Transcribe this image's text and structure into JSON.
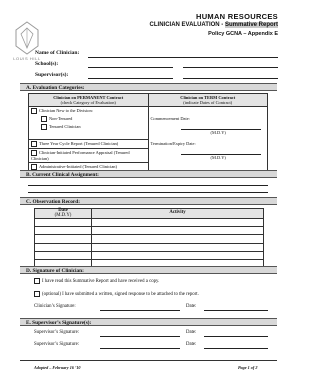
{
  "header": {
    "logo_text": "LOUIS HILL",
    "line1": "HUMAN RESOURCES",
    "line2_prefix": "CLINICIAN EVALUATION - ",
    "line2_highlight": "Summative Report",
    "line3": "Policy GCNA – Appendix E"
  },
  "fields": {
    "name_label": "Name of Clinician:",
    "schools_label": "School(s):",
    "supervisors_label": "Supervisor(s):"
  },
  "section_a": {
    "title": "A.  Evaluation Categories:",
    "permanent_head": "Clinician on PERMANENT Contract",
    "permanent_sub": "(check Category of Evaluation)",
    "term_head": "Clinician on TERM Contract",
    "term_sub": "(indicate Dates of Contract)",
    "opt_new": "Clinician New to the Division:",
    "opt_nontenured": "Non-Tenured",
    "opt_tenured": "Tenured Clinician",
    "opt_three_year": "Three Year Cycle Report (Tenured Clinician)",
    "opt_clinician_initiated": "Clinician-Initiated Performance Appraisal (Tenured Clinician)",
    "opt_admin_initiated": "Administrative-Initiated (Tenured Clinician)",
    "commencement_label": "Commencement Date:",
    "mdy1": "(M.D.Y)",
    "termination_label": "Termination/Expiry Date:",
    "mdy2": "(M.D.Y)"
  },
  "section_b": {
    "title": "B.  Current Clinical Assignment:"
  },
  "section_c": {
    "title": "C.  Observation Record:",
    "col_date": "Date",
    "col_date_sub": "(M.D.Y)",
    "col_activity": "Activity"
  },
  "section_d": {
    "title": "D.  Signature of Clinician:",
    "check1": "I have read this Summative Report and have received a copy.",
    "check2": "(optional) I have submitted a written, signed response to be attached to the report.",
    "sig_label": "Clinician’s Signature:",
    "date_label": "Date:"
  },
  "section_e": {
    "title": "E.  Supervisor’s Signature(s):",
    "sig1_label": "Supervisor’s Signature:",
    "date1_label": "Date:",
    "sig2_label": "Supervisor’s Signature:",
    "date2_label": "Date:"
  },
  "footer": {
    "adopted": "Adopted – February 16 ’10",
    "page": "Page 1 of 2"
  }
}
